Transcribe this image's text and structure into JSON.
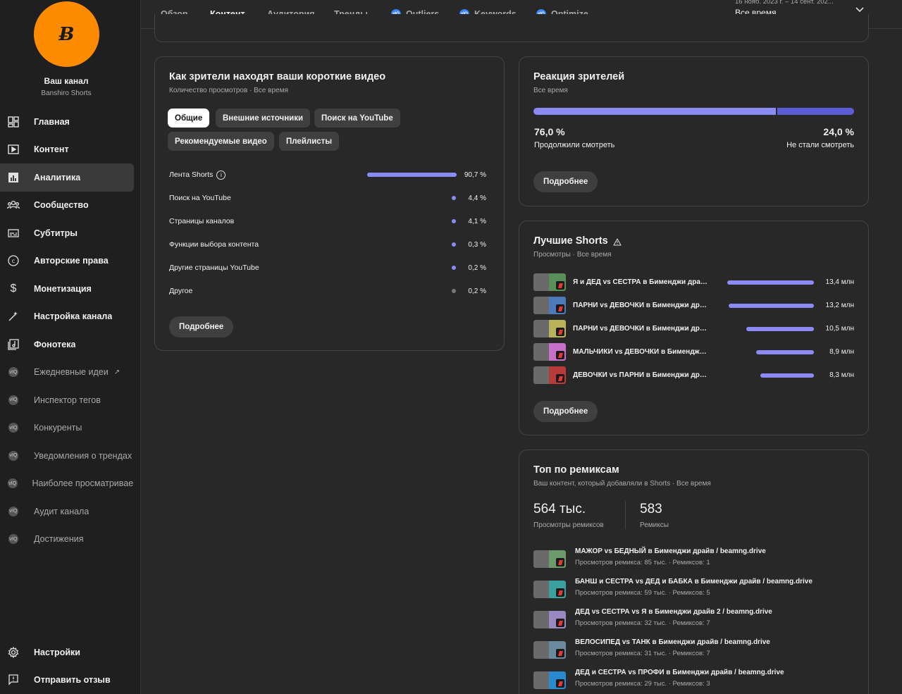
{
  "sidebar": {
    "avatar_text": "Ƀ",
    "channel_name": "Ваш канал",
    "channel_handle": "Banshiro Shorts",
    "items": [
      {
        "label": "Главная",
        "icon": "dashboard-icon"
      },
      {
        "label": "Контент",
        "icon": "content-icon"
      },
      {
        "label": "Аналитика",
        "icon": "analytics-icon"
      },
      {
        "label": "Сообщество",
        "icon": "community-icon"
      },
      {
        "label": "Субтитры",
        "icon": "subtitles-icon"
      },
      {
        "label": "Авторские права",
        "icon": "copyright-icon"
      },
      {
        "label": "Монетизация",
        "icon": "dollar-icon"
      },
      {
        "label": "Настройка канала",
        "icon": "magic-wand-icon"
      },
      {
        "label": "Фонотека",
        "icon": "audio-library-icon"
      }
    ],
    "ext_items": [
      {
        "label": "Ежедневные идеи"
      },
      {
        "label": "Инспектор тегов"
      },
      {
        "label": "Конкуренты"
      },
      {
        "label": "Уведомления о трендах"
      },
      {
        "label": "Наиболее просматриваемые"
      },
      {
        "label": "Аудит канала"
      },
      {
        "label": "Достижения"
      }
    ],
    "bottom": [
      {
        "label": "Настройки"
      },
      {
        "label": "Отправить отзыв"
      }
    ]
  },
  "tabs": {
    "overview": "Обзор",
    "content": "Контент",
    "audience": "Аудитория",
    "trends": "Тренды",
    "outliers": "Outliers",
    "keywords": "Keywords",
    "optimize": "Optimize",
    "ext_badge": "vIQ"
  },
  "date": {
    "range": "16 нояб. 2023 г. – 14 сент. 202...",
    "value": "Все время"
  },
  "sources_card": {
    "title": "Как зрители находят ваши короткие видео",
    "subtitle": "Количество просмотров · Все время",
    "chips": [
      "Общие",
      "Внешние источники",
      "Поиск на YouTube",
      "Рекомендуемые видео",
      "Плейлисты"
    ],
    "rows": [
      {
        "label": "Лента Shorts",
        "value": "90,7 %",
        "pct": 90.7
      },
      {
        "label": "Поиск на YouTube",
        "value": "4,4 %",
        "pct": 4.4
      },
      {
        "label": "Страницы каналов",
        "value": "4,1 %",
        "pct": 4.1
      },
      {
        "label": "Функции выбора контента",
        "value": "0,3 %",
        "pct": 0.3
      },
      {
        "label": "Другие страницы YouTube",
        "value": "0,2 %",
        "pct": 0.2
      },
      {
        "label": "Другое",
        "value": "0,2 %",
        "pct": 0.2
      }
    ],
    "more": "Подробнее"
  },
  "retention_card": {
    "title": "Реакция зрителей",
    "subtitle": "Все время",
    "continued_pct": 76.0,
    "continued_value": "76,0 %",
    "continued_label": "Продолжили смотреть",
    "stopped_value": "24,0 %",
    "stopped_label": "Не стали смотреть",
    "more": "Подробнее"
  },
  "top_shorts_card": {
    "title": "Лучшие Shorts",
    "warning_icon": "warning-icon",
    "subtitle": "Просмотры · Все время",
    "items": [
      {
        "title": "Я и ДЕД vs СЕСТРА в Бименджи драйв / beamng.drive",
        "value": "13,4 млн",
        "views": 13.4,
        "thumb": "#5a8f5a"
      },
      {
        "title": "ПАРНИ vs ДЕВОЧКИ в Бименджи драйв / beamng.drive",
        "value": "13,2 млн",
        "views": 13.2,
        "thumb": "#4d7ab8"
      },
      {
        "title": "ПАРНИ vs ДЕВОЧКИ в Бименджи драйв / beamng.drive",
        "value": "10,5 млн",
        "views": 10.5,
        "thumb": "#b8b25a"
      },
      {
        "title": "МАЛЬЧИКИ vs ДЕВОЧКИ в Бименджи драйв / beamng.drive",
        "value": "8,9 млн",
        "views": 8.9,
        "thumb": "#c870c8"
      },
      {
        "title": "ДЕВОЧКИ vs ПАРНИ в Бименджи драйв / beamng.drive",
        "value": "8,3 млн",
        "views": 8.3,
        "thumb": "#b83a3a"
      }
    ],
    "more": "Подробнее"
  },
  "remix_card": {
    "title": "Топ по ремиксам",
    "subtitle": "Ваш контент, который добавляли в Shorts · Все время",
    "remix_views": "564 тыс.",
    "remix_views_label": "Просмотры ремиксов",
    "remixes": "583",
    "remixes_label": "Ремиксы",
    "items": [
      {
        "title": "МАЖОР vs БЕДНЫЙ в Бименджи драйв / beamng.drive",
        "meta": "Просмотров ремикса: 85 тыс. · Ремиксов: 1",
        "thumb": "#6c9a6c"
      },
      {
        "title": "БАНШ и СЕСТРА vs ДЕД и БАБКА в Бименджи драйв / beamng.drive",
        "meta": "Просмотров ремикса: 59 тыс. · Ремиксов: 5",
        "thumb": "#3aa0a0"
      },
      {
        "title": "ДЕД vs СЕСТРА vs Я в Бименджи драйв 2 / beamng.drive",
        "meta": "Просмотров ремикса: 32 тыс. · Ремиксов: 7",
        "thumb": "#9a88c0"
      },
      {
        "title": "ВЕЛОСИПЕД vs ТАНК в Бименджи драйв / beamng.drive",
        "meta": "Просмотров ремикса: 31 тыс. · Ремиксов: 7",
        "thumb": "#6a8aa0"
      },
      {
        "title": "ДЕД и СЕСТРА vs ПРОФИ в Бименджи драйв / beamng.drive",
        "meta": "Просмотров ремикса: 29 тыс. · Ремиксов: 3",
        "thumb": "#2a8ad0"
      }
    ]
  },
  "colors": {
    "accent": "#8b8af7",
    "accent_dark": "#5e5bd6",
    "avatar": "#ff8c00",
    "badge": "#3b82f6"
  }
}
